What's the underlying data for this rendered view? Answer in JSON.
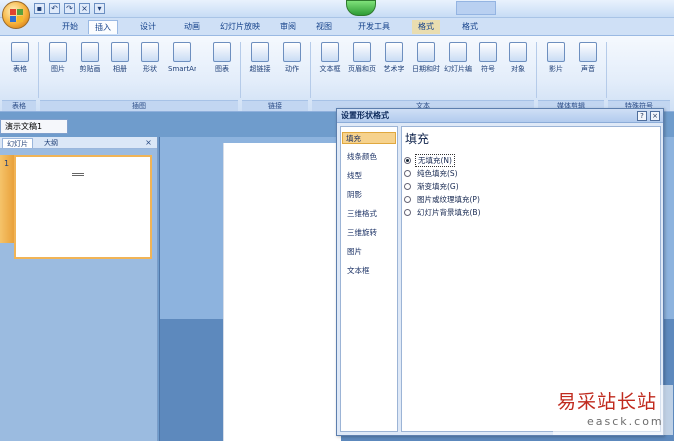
{
  "tabs": [
    {
      "label": "开始"
    },
    {
      "label": "插入"
    },
    {
      "label": "设计"
    },
    {
      "label": "动画"
    },
    {
      "label": "幻灯片放映"
    },
    {
      "label": "审阅"
    },
    {
      "label": "视图"
    },
    {
      "label": "开发工具"
    },
    {
      "label": "格式"
    },
    {
      "label": "格式"
    }
  ],
  "ribbon": {
    "buttons": [
      {
        "label": "表格"
      },
      {
        "label": "图片"
      },
      {
        "label": "剪贴画"
      },
      {
        "label": "相册"
      },
      {
        "label": "形状"
      },
      {
        "label": "SmartArt"
      },
      {
        "label": "图表"
      },
      {
        "label": "超链接"
      },
      {
        "label": "动作"
      },
      {
        "label": "文本框"
      },
      {
        "label": "页眉和页脚"
      },
      {
        "label": "艺术字"
      },
      {
        "label": "日期和时间"
      },
      {
        "label": "幻灯片编号"
      },
      {
        "label": "符号"
      },
      {
        "label": "对象"
      },
      {
        "label": "影片"
      },
      {
        "label": "声音"
      }
    ],
    "groups": [
      {
        "label": "表格"
      },
      {
        "label": "插图"
      },
      {
        "label": "链接"
      },
      {
        "label": "文本"
      },
      {
        "label": "媒体剪辑"
      },
      {
        "label": "特殊符号"
      }
    ]
  },
  "document_tab": "演示文稿1",
  "left_pane": {
    "tabs": [
      {
        "label": "幻灯片"
      },
      {
        "label": "大纲"
      }
    ],
    "close": "×",
    "slide_number": "1"
  },
  "dialog": {
    "title": "设置形状格式",
    "help": "?",
    "close": "×",
    "nav_items": [
      {
        "label": "填充"
      },
      {
        "label": "线条颜色"
      },
      {
        "label": "线型"
      },
      {
        "label": "阴影"
      },
      {
        "label": "三维格式"
      },
      {
        "label": "三维旋转"
      },
      {
        "label": "图片"
      },
      {
        "label": "文本框"
      }
    ],
    "section_title": "填充",
    "options": [
      {
        "label": "无填充(N)",
        "checked": true
      },
      {
        "label": "纯色填充(S)",
        "checked": false
      },
      {
        "label": "渐变填充(G)",
        "checked": false
      },
      {
        "label": "图片或纹理填充(P)",
        "checked": false
      },
      {
        "label": "幻灯片背景填充(B)",
        "checked": false
      }
    ]
  },
  "watermark": {
    "text_cn": "易采站长站",
    "text_en": "easck.com"
  },
  "colors": {
    "accent_selected": "#f6d28d",
    "ribbon": "#e3edfa",
    "workspace": "#6f9ccc",
    "watermark_red": "#c02a1e"
  }
}
